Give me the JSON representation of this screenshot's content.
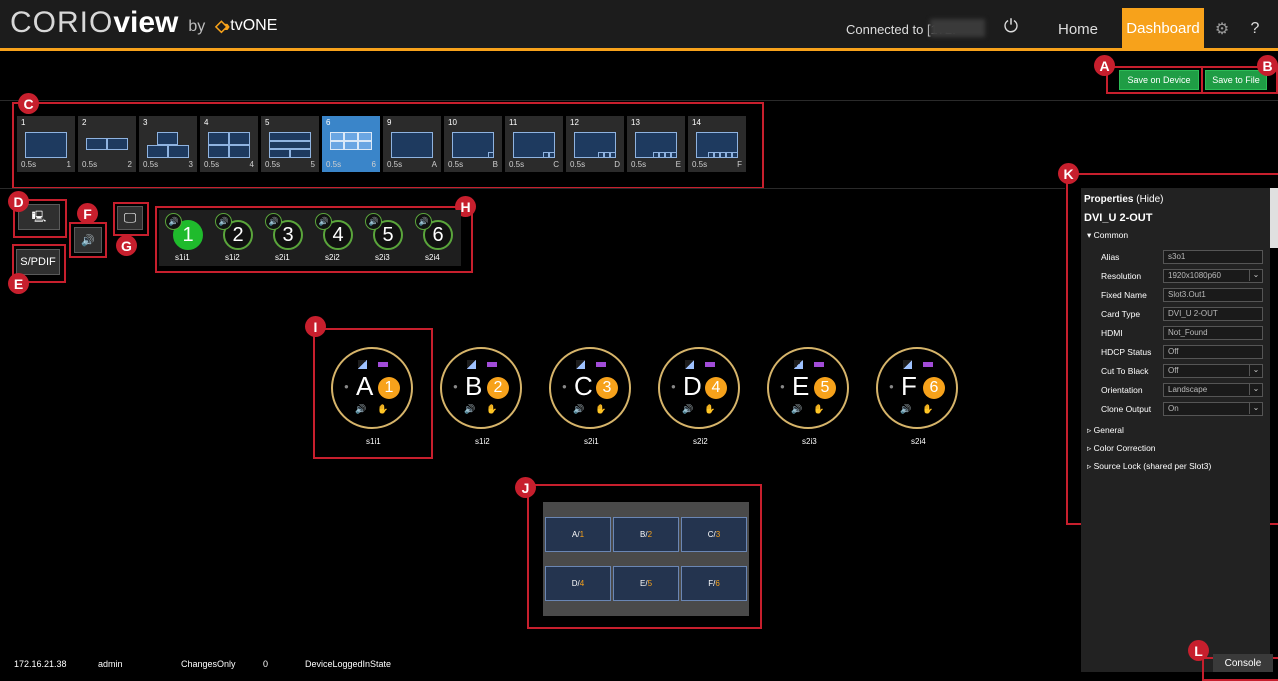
{
  "header": {
    "logo_part1": "CORIO",
    "logo_part2": "view",
    "logo_by": "by",
    "logo_brand": "tvONE",
    "connection_text": "Connected to [172.",
    "nav": {
      "home": "Home",
      "dashboard": "Dashboard",
      "help": "?"
    },
    "accent_color": "#f7a21b"
  },
  "toolbar": {
    "save_device": "Save on Device",
    "save_file": "Save to File"
  },
  "callouts": [
    "A",
    "B",
    "C",
    "D",
    "E",
    "F",
    "G",
    "H",
    "I",
    "J",
    "K",
    "L"
  ],
  "presets": [
    {
      "num": "1",
      "dur": "0.5s",
      "code": "1"
    },
    {
      "num": "2",
      "dur": "0.5s",
      "code": "2"
    },
    {
      "num": "3",
      "dur": "0.5s",
      "code": "3"
    },
    {
      "num": "4",
      "dur": "0.5s",
      "code": "4"
    },
    {
      "num": "5",
      "dur": "0.5s",
      "code": "5"
    },
    {
      "num": "6",
      "dur": "0.5s",
      "code": "6",
      "active": true
    },
    {
      "num": "9",
      "dur": "0.5s",
      "code": "A"
    },
    {
      "num": "10",
      "dur": "0.5s",
      "code": "B"
    },
    {
      "num": "11",
      "dur": "0.5s",
      "code": "C"
    },
    {
      "num": "12",
      "dur": "0.5s",
      "code": "D"
    },
    {
      "num": "13",
      "dur": "0.5s",
      "code": "E"
    },
    {
      "num": "14",
      "dur": "0.5s",
      "code": "F"
    }
  ],
  "left_panel": {
    "spdif": "S/PDIF"
  },
  "audio_sources": [
    {
      "num": "1",
      "label": "s1i1",
      "active": true
    },
    {
      "num": "2",
      "label": "s1i2"
    },
    {
      "num": "3",
      "label": "s2i1"
    },
    {
      "num": "4",
      "label": "s2i2"
    },
    {
      "num": "5",
      "label": "s2i3"
    },
    {
      "num": "6",
      "label": "s2i4"
    }
  ],
  "canvas_sources": [
    {
      "letter": "A",
      "num": "1",
      "label": "s1i1"
    },
    {
      "letter": "B",
      "num": "2",
      "label": "s1i2"
    },
    {
      "letter": "C",
      "num": "3",
      "label": "s2i1"
    },
    {
      "letter": "D",
      "num": "4",
      "label": "s2i2"
    },
    {
      "letter": "E",
      "num": "5",
      "label": "s2i3"
    },
    {
      "letter": "F",
      "num": "6",
      "label": "s2i4"
    }
  ],
  "layout_grid": [
    {
      "letter": "A",
      "num": "1"
    },
    {
      "letter": "B",
      "num": "2"
    },
    {
      "letter": "C",
      "num": "3"
    },
    {
      "letter": "D",
      "num": "4"
    },
    {
      "letter": "E",
      "num": "5"
    },
    {
      "letter": "F",
      "num": "6"
    }
  ],
  "properties": {
    "title": "Properties",
    "hide": "(Hide)",
    "device": "DVI_U 2-OUT",
    "common": "Common",
    "rows": [
      {
        "label": "Alias",
        "value": "s3o1",
        "dropdown": false
      },
      {
        "label": "Resolution",
        "value": "1920x1080p60",
        "dropdown": true
      },
      {
        "label": "Fixed Name",
        "value": "Slot3.Out1",
        "dropdown": false
      },
      {
        "label": "Card Type",
        "value": "DVI_U 2-OUT",
        "dropdown": false
      },
      {
        "label": "HDMI",
        "value": "Not_Found",
        "dropdown": false
      },
      {
        "label": "HDCP Status",
        "value": "Off",
        "dropdown": false
      },
      {
        "label": "Cut To Black",
        "value": "Off",
        "dropdown": true
      },
      {
        "label": "Orientation",
        "value": "Landscape",
        "dropdown": true
      },
      {
        "label": "Clone Output",
        "value": "On",
        "dropdown": true
      }
    ],
    "sections": [
      "General",
      "Color Correction",
      "Source Lock (shared per Slot3)"
    ]
  },
  "footer": {
    "ip": "172.16.21.38",
    "user": "admin",
    "mode": "ChangesOnly",
    "count": "0",
    "state": "DeviceLoggedInState",
    "console": "Console"
  }
}
